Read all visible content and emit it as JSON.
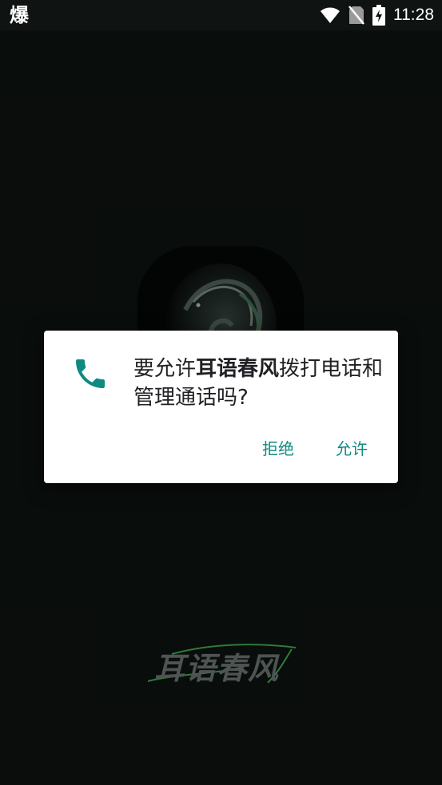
{
  "status_bar": {
    "app_glyph": "爆",
    "time": "11:28",
    "icons": [
      "wifi-icon",
      "no-sim-icon",
      "battery-charging-icon"
    ]
  },
  "splash": {
    "brand_wordmark": "耳语春风"
  },
  "dialog": {
    "icon": "phone-icon",
    "message_prefix": "要允许",
    "app_name": "耳语春风",
    "message_suffix": "拨打电话和管理通话吗?",
    "deny_label": "拒绝",
    "allow_label": "允许",
    "accent_color": "#0f8a80"
  }
}
